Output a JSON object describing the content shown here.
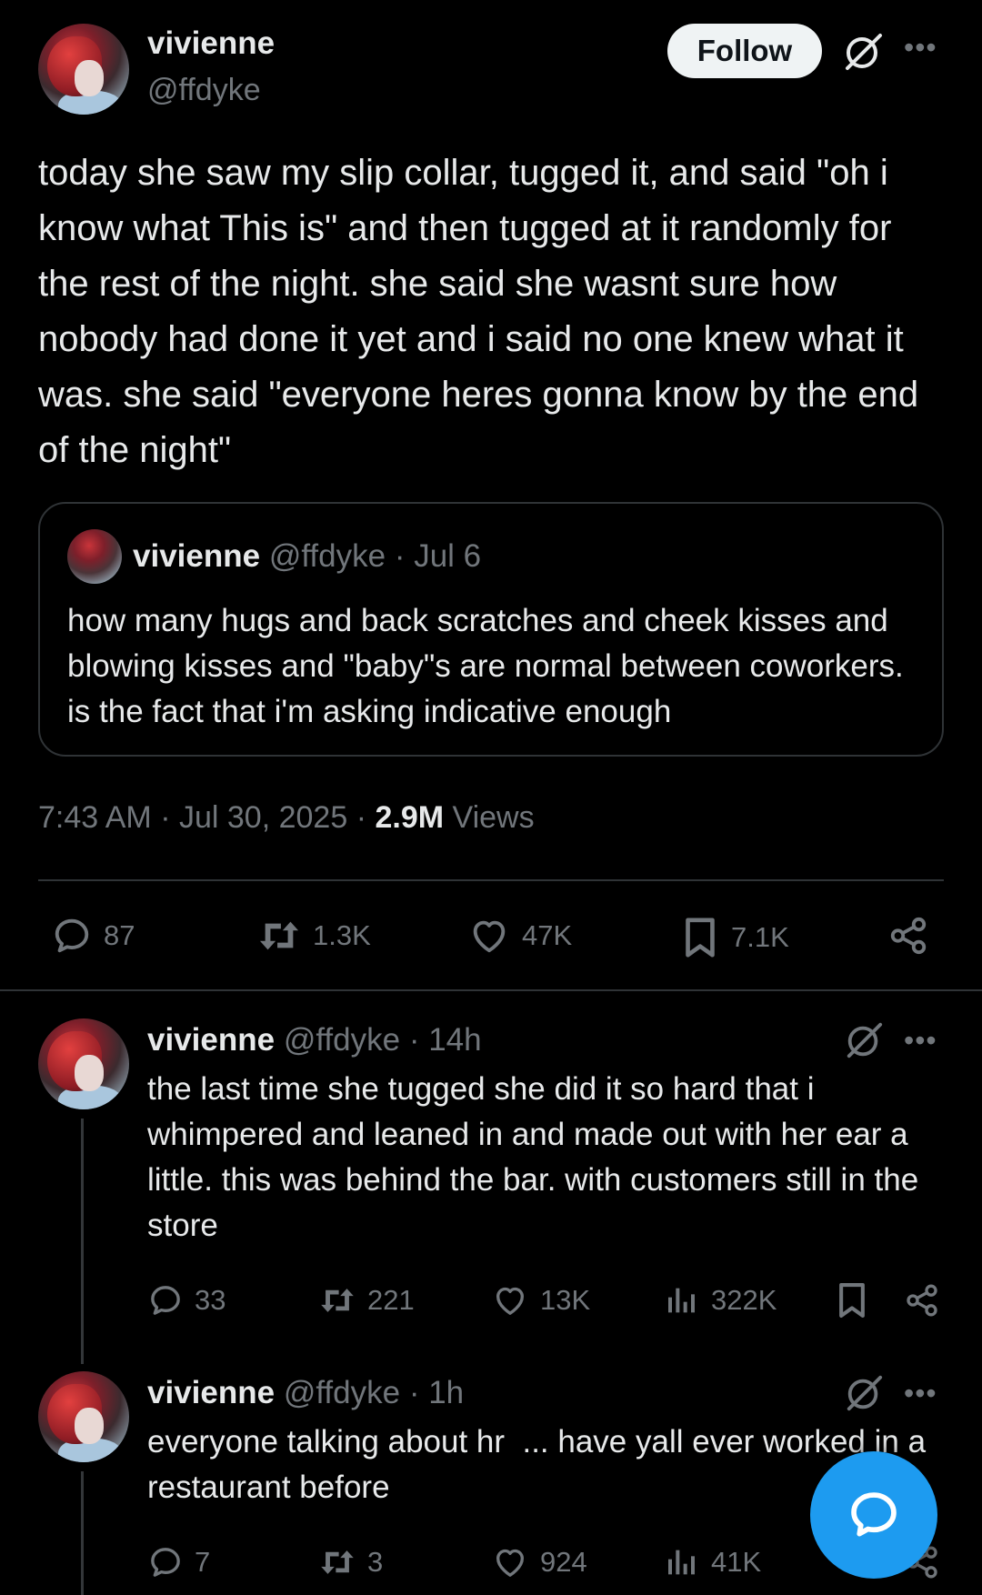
{
  "main_tweet": {
    "author_name": "vivienne",
    "author_handle": "@ffdyke",
    "follow_label": "Follow",
    "text": "today she saw my slip collar, tugged it, and said \"oh i know what This is\" and then tugged at it randomly for the rest of the night. she said she wasnt sure how nobody had done it yet and i said no one knew what it was. she said \"everyone heres gonna know by the end of the night\"",
    "time": "7:43 AM",
    "date": "Jul 30, 2025",
    "views_count": "2.9M",
    "views_label": "Views",
    "stats": {
      "replies": "87",
      "reposts": "1.3K",
      "likes": "47K",
      "bookmarks": "7.1K"
    }
  },
  "quoted_tweet": {
    "author_name": "vivienne",
    "author_handle": "@ffdyke",
    "date": "Jul 6",
    "text": "how many hugs and back scratches and cheek kisses and blowing kisses and \"baby\"s are normal between coworkers. is the fact that i'm asking indicative enough"
  },
  "replies": [
    {
      "author_name": "vivienne",
      "author_handle": "@ffdyke",
      "age": "14h",
      "text": "the last time she tugged she did it so hard that i whimpered and leaned in and made out with her ear a little. this was behind the bar. with customers still in the store",
      "stats": {
        "replies": "33",
        "reposts": "221",
        "likes": "13K",
        "views": "322K"
      }
    },
    {
      "author_name": "vivienne",
      "author_handle": "@ffdyke",
      "age": "1h",
      "text": "everyone talking about hr  ... have yall ever worked in a restaurant before",
      "stats": {
        "replies": "7",
        "reposts": "3",
        "likes": "924",
        "views": "41K"
      }
    }
  ],
  "separator": "·",
  "colors": {
    "background": "#000000",
    "text": "#e7e9ea",
    "muted": "#71767b",
    "border": "#2f3336",
    "accent": "#1d9bf0"
  },
  "icons": [
    "grok-icon",
    "more-icon",
    "reply-icon",
    "repost-icon",
    "like-icon",
    "bookmark-icon",
    "share-icon",
    "views-icon",
    "compose-message-icon"
  ]
}
